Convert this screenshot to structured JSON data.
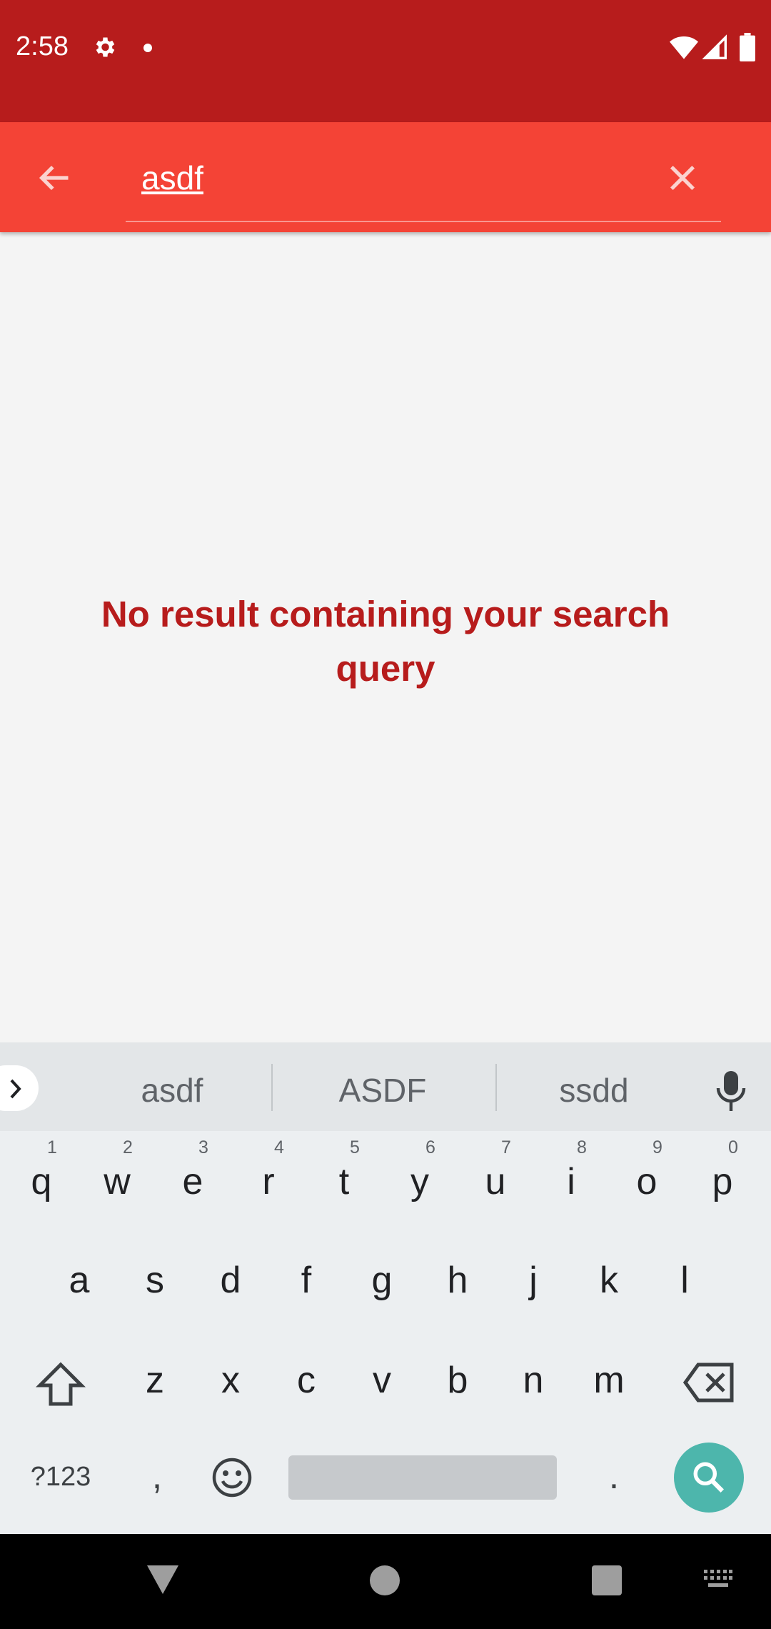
{
  "status_bar": {
    "time": "2:58"
  },
  "search": {
    "query": "asdf"
  },
  "results": {
    "empty_message": "No result containing your search query"
  },
  "keyboard": {
    "suggestions": [
      "asdf",
      "ASDF",
      "ssdd"
    ],
    "row1": [
      {
        "key": "q",
        "hint": "1"
      },
      {
        "key": "w",
        "hint": "2"
      },
      {
        "key": "e",
        "hint": "3"
      },
      {
        "key": "r",
        "hint": "4"
      },
      {
        "key": "t",
        "hint": "5"
      },
      {
        "key": "y",
        "hint": "6"
      },
      {
        "key": "u",
        "hint": "7"
      },
      {
        "key": "i",
        "hint": "8"
      },
      {
        "key": "o",
        "hint": "9"
      },
      {
        "key": "p",
        "hint": "0"
      }
    ],
    "row2": [
      "a",
      "s",
      "d",
      "f",
      "g",
      "h",
      "j",
      "k",
      "l"
    ],
    "row3": [
      "z",
      "x",
      "c",
      "v",
      "b",
      "n",
      "m"
    ],
    "symbols_label": "?123",
    "comma": ",",
    "period": "."
  },
  "colors": {
    "status_bar": "#b71c1c",
    "toolbar": "#f44336",
    "message": "#b71c1c",
    "search_key": "#4db6ac"
  }
}
